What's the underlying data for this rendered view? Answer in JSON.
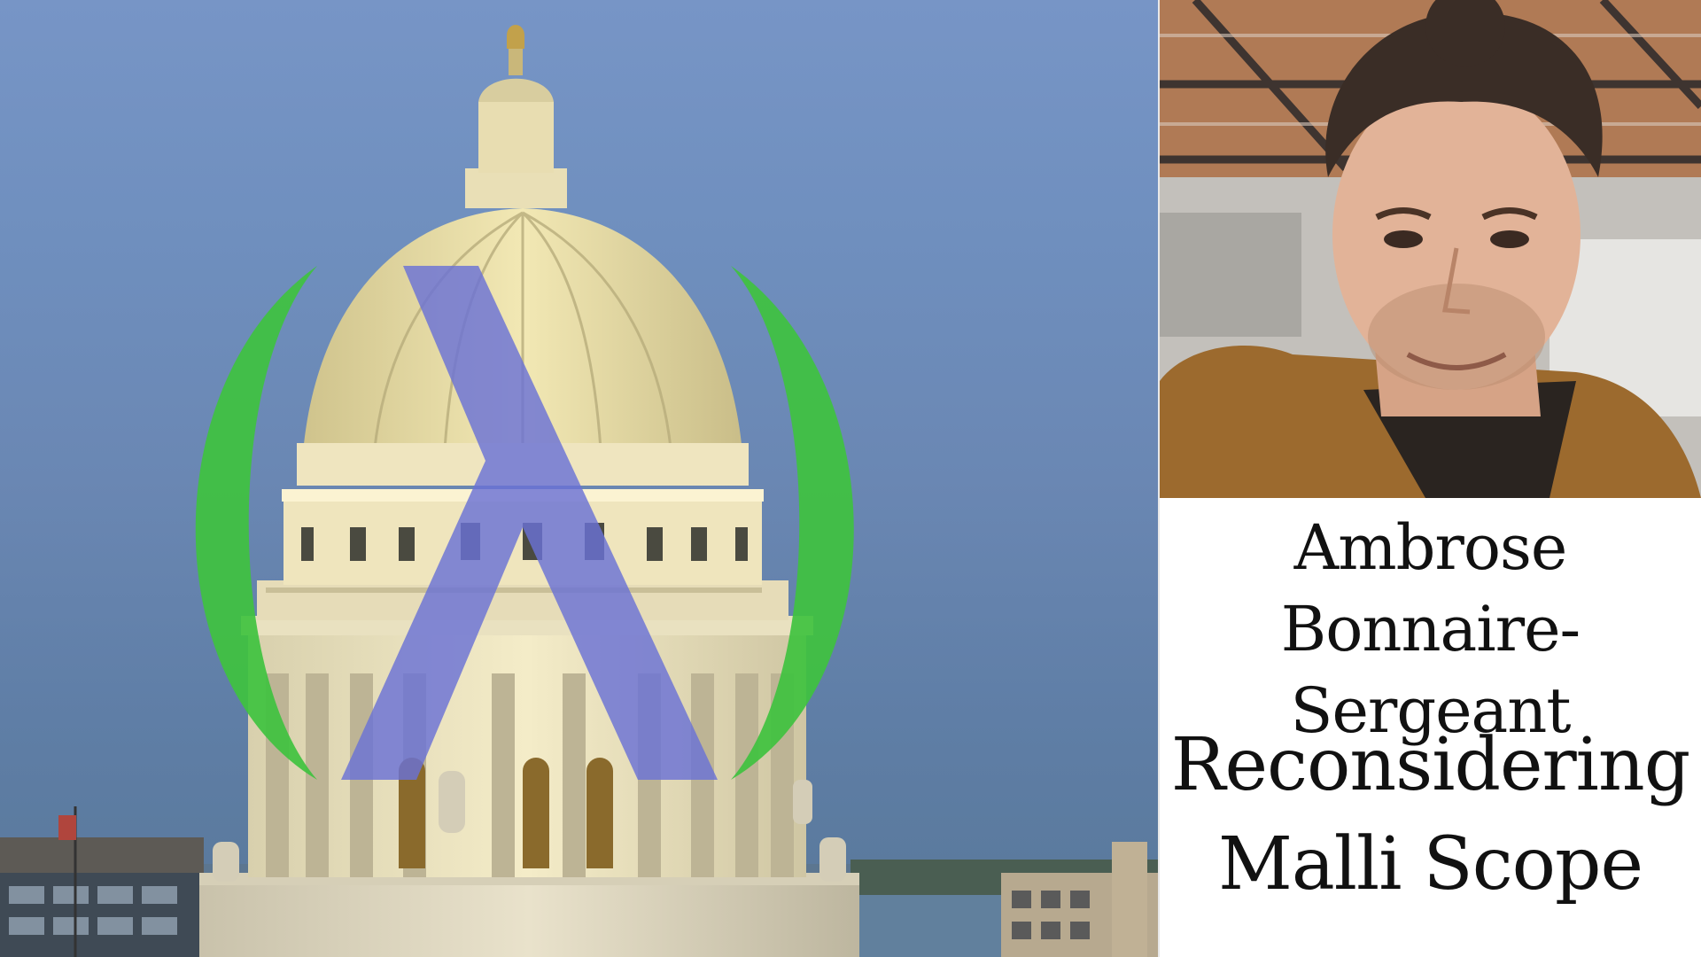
{
  "speaker": {
    "name": "Ambrose Bonnaire-Sergeant"
  },
  "talk": {
    "title": "Reconsidering Malli Scope"
  },
  "logo": {
    "icon": "lambda-in-parentheses-logo",
    "paren_color": "#3fc23f",
    "lambda_color": "#6a72d6"
  }
}
